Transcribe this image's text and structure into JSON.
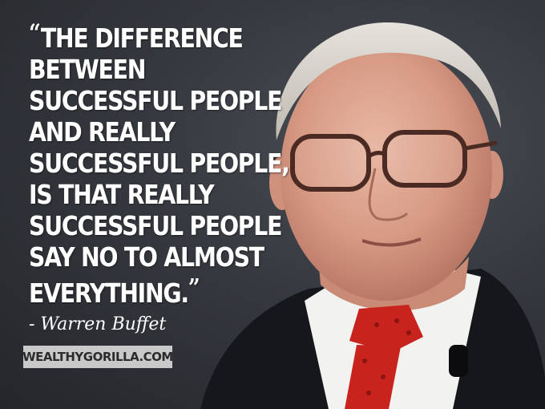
{
  "quote": {
    "open_mark": "“",
    "lines": [
      "THE DIFFERENCE",
      "BETWEEN",
      "SUCCESSFUL PEOPLE",
      "AND REALLY",
      "SUCCESSFUL PEOPLE,",
      "IS THAT REALLY",
      "SUCCESSFUL PEOPLE",
      "SAY NO TO ALMOST",
      "EVERYTHING."
    ],
    "close_mark": "”"
  },
  "author": "- Warren Buffet",
  "watermark": "WEALTHYGORILLA.COM",
  "colors": {
    "text": "#ffffff",
    "background": "#34373d",
    "badge": "#c9c9c9",
    "tie": "#c8231c",
    "suit": "#15171b"
  }
}
